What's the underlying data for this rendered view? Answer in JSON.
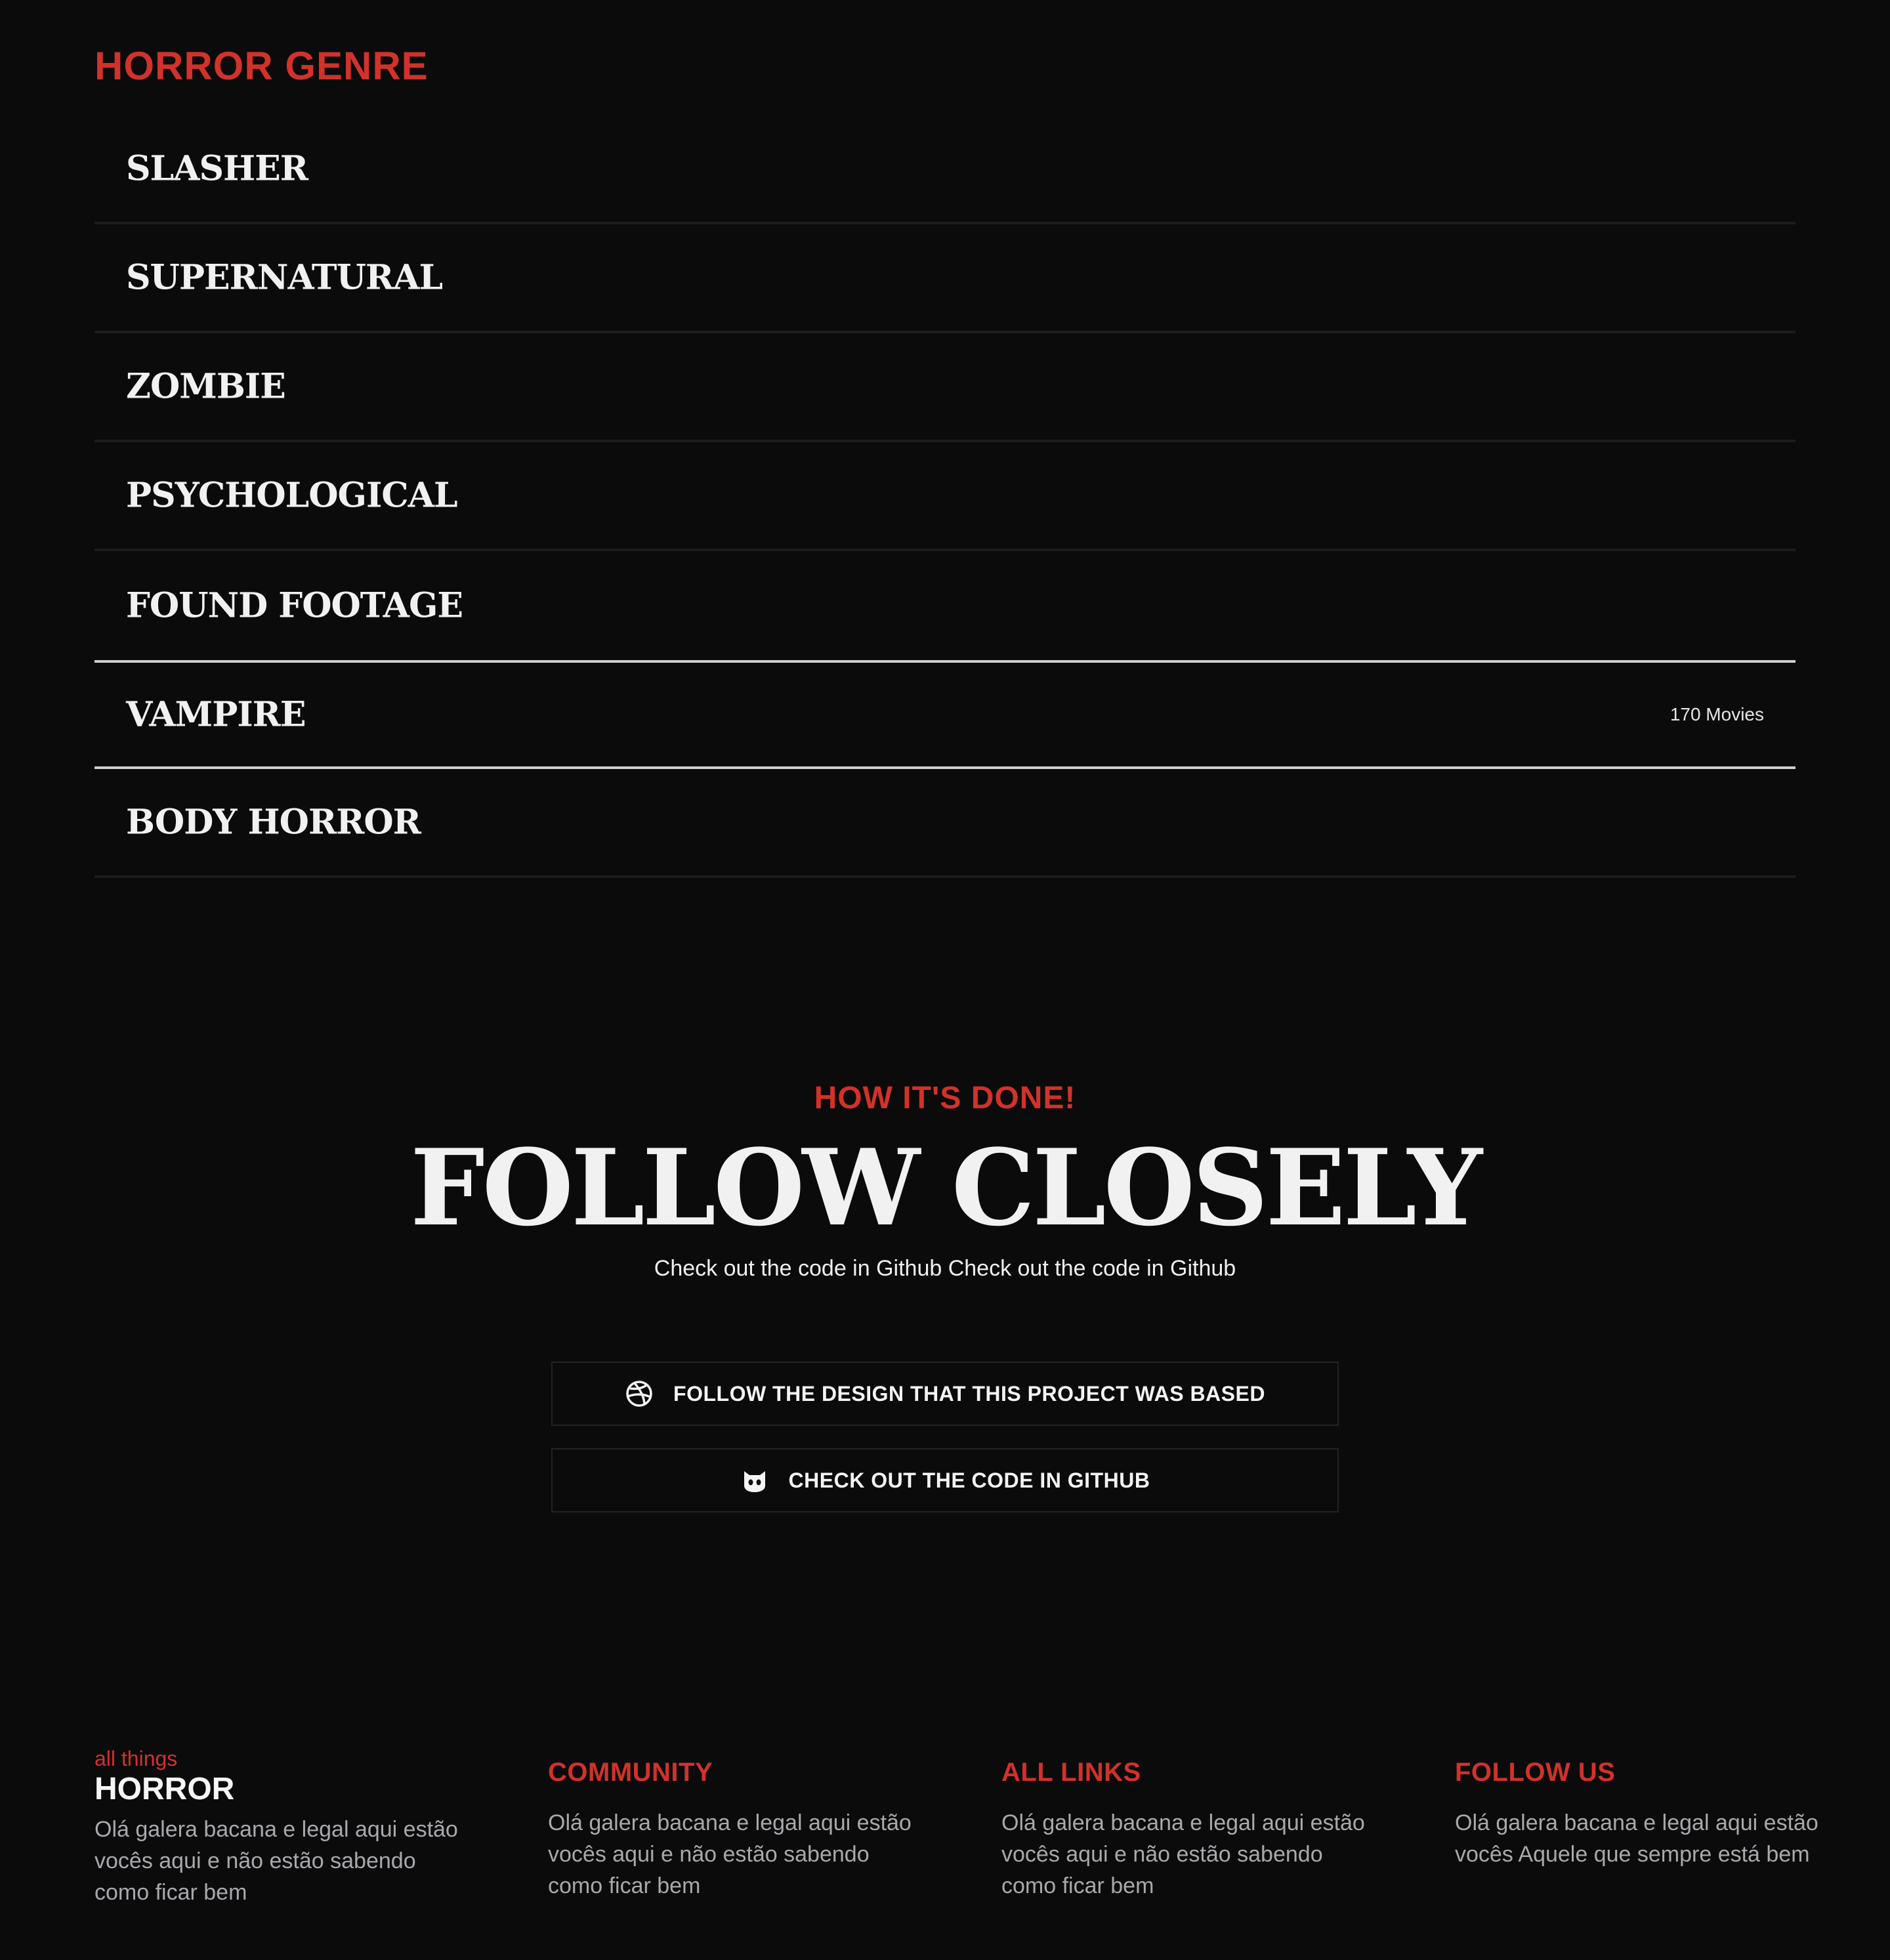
{
  "genre_section": {
    "title": "HORROR GENRE",
    "items": [
      {
        "label": "SLASHER"
      },
      {
        "label": "SUPERNATURAL"
      },
      {
        "label": "ZOMBIE"
      },
      {
        "label": "PSYCHOLOGICAL"
      },
      {
        "label": "FOUND FOOTAGE"
      },
      {
        "label": "VAMPIRE",
        "count": "170 Movies"
      },
      {
        "label": "BODY HORROR"
      }
    ]
  },
  "how_section": {
    "kicker": "HOW IT'S DONE!",
    "title": "FOLLOW CLOSELY",
    "subtitle": "Check out the code in Github Check out the code in Github",
    "buttons": [
      {
        "label": "FOLLOW THE DESIGN THAT THIS PROJECT WAS BASED",
        "icon": "dribbble-icon"
      },
      {
        "label": "CHECK OUT THE CODE IN GITHUB",
        "icon": "github-icon"
      }
    ]
  },
  "footer": {
    "brand_small": "all things",
    "brand_big": "HORROR",
    "brand_text": "Olá galera bacana e legal aqui estão vocês aqui e não estão sabendo como ficar bem",
    "columns": [
      {
        "heading": "COMMUNITY",
        "text": "Olá galera bacana e legal aqui estão vocês aqui e não estão sabendo como ficar bem"
      },
      {
        "heading": "ALL LINKS",
        "text": "Olá galera bacana e legal aqui estão vocês aqui e não estão sabendo como ficar bem"
      },
      {
        "heading": "FOLLOW US",
        "text": "Olá galera bacana e legal aqui estão vocês Aquele que sempre está bem"
      }
    ]
  },
  "colors": {
    "background": "#0b0b0c",
    "accent": "#d1322a",
    "text": "#f1f1f1",
    "muted": "#a9a9ad"
  }
}
